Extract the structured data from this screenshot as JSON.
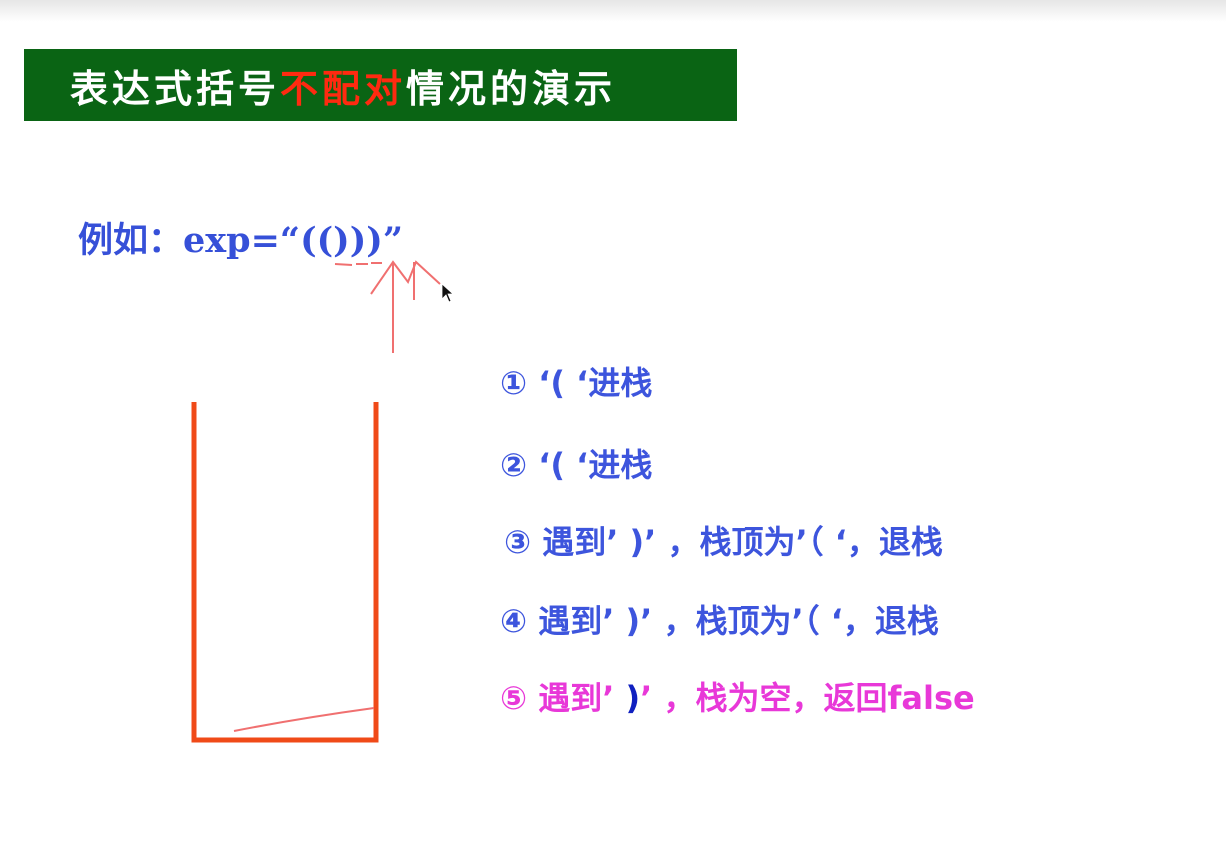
{
  "slide": {
    "title_before": "表达式括号",
    "title_highlight": "不配对",
    "title_after": "情况的演示",
    "example": "例如：exp=“(()))”"
  },
  "steps": [
    {
      "num": "①",
      "text": " ‘( ‘进栈"
    },
    {
      "num": "②",
      "text": " ‘( ‘进栈"
    },
    {
      "num": "③",
      "text": " 遇到’ )’ ，栈顶为’（ ‘，退栈"
    },
    {
      "num": "④",
      "text": " 遇到’ )’ ，栈顶为’（ ‘，退栈"
    },
    {
      "num": "⑤",
      "text_a": " 遇到’ ",
      "text_paren": ")",
      "text_b": "’ ，栈为空，返回false"
    }
  ],
  "colors": {
    "title_bg": "#0a6414",
    "title_highlight": "#ff2a10",
    "text_blue": "#3d55dd",
    "text_magenta": "#e838d8",
    "stack_outline": "#f04a18",
    "annotation": "#f07070"
  },
  "icons": {
    "cursor": "mouse-pointer-icon"
  }
}
